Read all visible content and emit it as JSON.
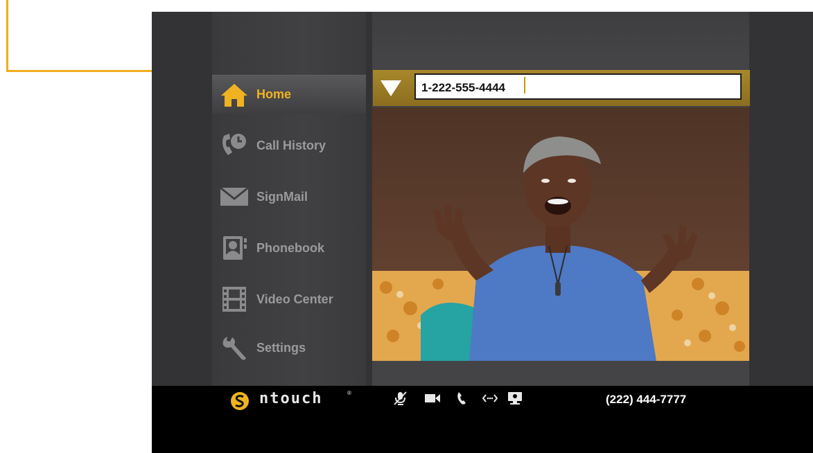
{
  "nav": {
    "items": [
      {
        "label": "Home",
        "icon": "home-icon",
        "active": true
      },
      {
        "label": "Call History",
        "icon": "call-history-icon"
      },
      {
        "label": "SignMail",
        "icon": "envelope-icon"
      },
      {
        "label": "Phonebook",
        "icon": "phonebook-icon"
      },
      {
        "label": "Video Center",
        "icon": "film-icon"
      },
      {
        "label": "Settings",
        "icon": "wrench-icon"
      }
    ]
  },
  "dial": {
    "value": "1-222-555-4444"
  },
  "brand": {
    "name": "ntouch",
    "registered": "®"
  },
  "status_bar": {
    "icons": [
      "mic-muted-icon",
      "video-camera-icon",
      "phone-icon",
      "connection-arrows-icon",
      "display-icon"
    ],
    "phone_number": "(222) 444-7777"
  },
  "colors": {
    "accent": "#efb321",
    "callout": "#f1ad1d",
    "background": "#333335",
    "bottom_bar": "#000000"
  }
}
